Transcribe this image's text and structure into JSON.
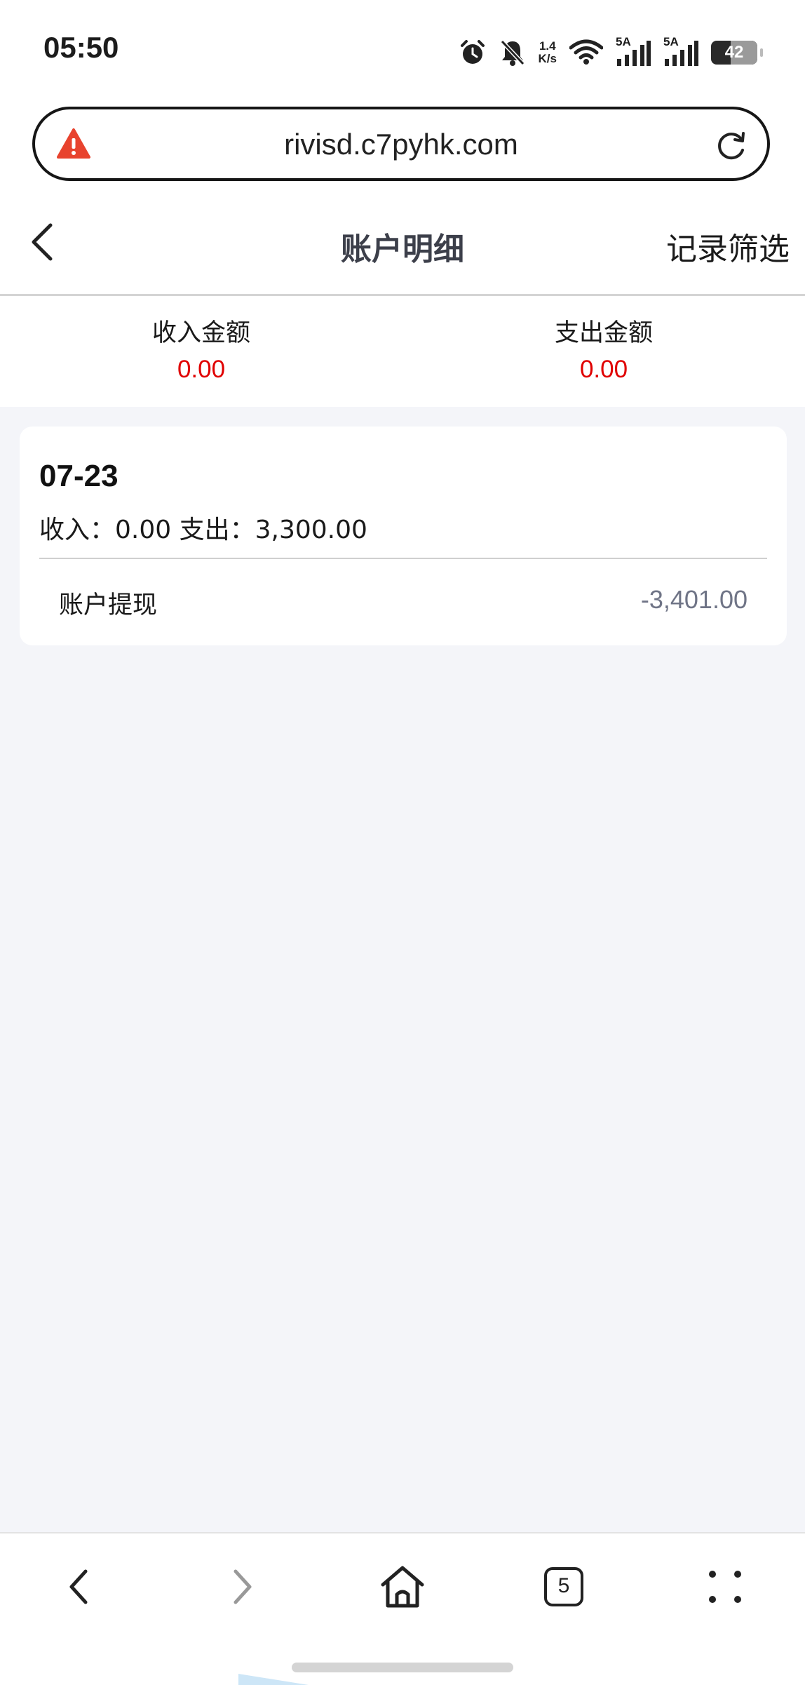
{
  "status_bar": {
    "time": "05:50",
    "net_speed_value": "1.4",
    "net_speed_unit": "K/s",
    "signal_1_label": "5A",
    "signal_2_label": "5A",
    "battery": "42",
    "battery_level": 0.42,
    "icons": [
      "alarm-icon",
      "mute-bell-icon",
      "wifi-icon",
      "signal-icon",
      "signal-icon",
      "battery-icon"
    ]
  },
  "browser": {
    "url": "rivisd.c7pyhk.com",
    "security_icon": "warning-icon",
    "reload_icon": "reload-icon"
  },
  "header": {
    "title": "账户明细",
    "filter_label": "记录筛选",
    "back_icon": "chevron-left-icon"
  },
  "summary": {
    "income_label": "收入金额",
    "income_value": "0.00",
    "expense_label": "支出金额",
    "expense_value": "0.00",
    "value_color": "#e00000"
  },
  "records": [
    {
      "date": "07-23",
      "daily_summary": "收入：0.00 支出：3,300.00",
      "items": [
        {
          "label": "账户提现",
          "amount": "-3,401.00"
        }
      ]
    }
  ],
  "bottom_nav": {
    "tab_count": "5",
    "icons": [
      "back-icon",
      "forward-icon",
      "home-icon",
      "tabs-icon",
      "more-icon"
    ]
  }
}
